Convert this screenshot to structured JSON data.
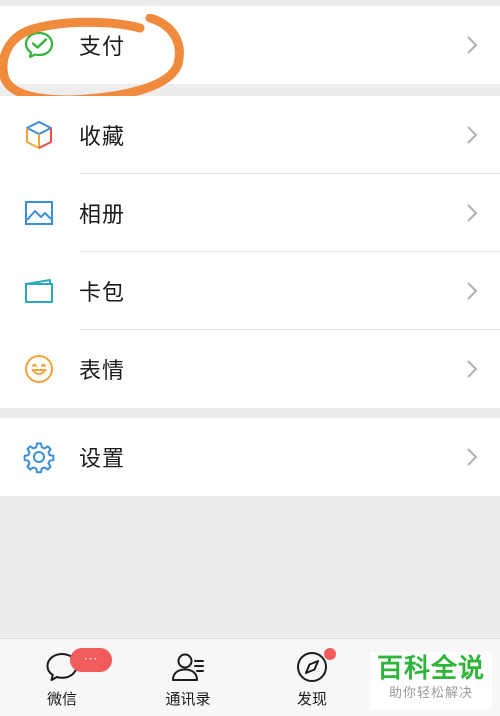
{
  "menu": {
    "pay": {
      "label": "支付",
      "icon": "wechat-pay-icon"
    },
    "favorites": {
      "label": "收藏",
      "icon": "cube-icon"
    },
    "album": {
      "label": "相册",
      "icon": "photo-icon"
    },
    "cards": {
      "label": "卡包",
      "icon": "card-wallet-icon"
    },
    "stickers": {
      "label": "表情",
      "icon": "smiley-icon"
    },
    "settings": {
      "label": "设置",
      "icon": "gear-icon"
    }
  },
  "tabs": [
    {
      "label": "微信",
      "icon": "chat-bubble-icon",
      "badge": "···"
    },
    {
      "label": "通讯录",
      "icon": "contacts-icon"
    },
    {
      "label": "发现",
      "icon": "compass-icon"
    }
  ],
  "watermark": {
    "title": "百科全说",
    "subtitle": "助你轻松解决"
  },
  "colors": {
    "accent_green": "#2fb53a",
    "badge_red": "#f25b5b",
    "highlight_orange": "#f08a3c",
    "icon_blue": "#3b8ed8",
    "background": "#ededed"
  }
}
